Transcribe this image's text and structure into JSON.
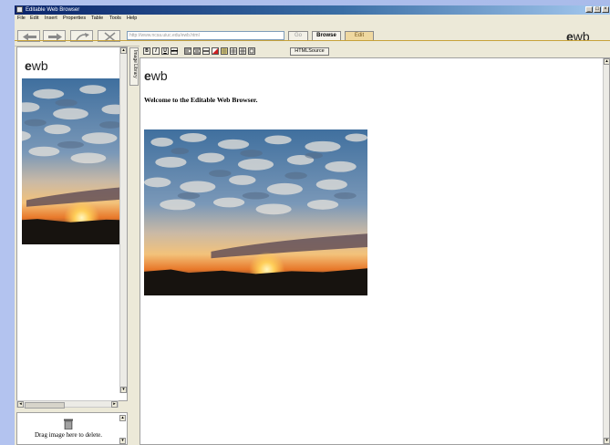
{
  "window": {
    "title": "Editable Web Browser",
    "controls": [
      "_",
      "□",
      "×"
    ]
  },
  "menu": [
    "File",
    "Edit",
    "Insert",
    "Properties",
    "Table",
    "Tools",
    "Help"
  ],
  "nav": {
    "url": "http://www.ncsa.uiuc.edu/ewb.html",
    "go_label": "Go",
    "browse_label": "Browse",
    "edit_label": "Edit",
    "logo_e": "e",
    "logo_rest": "wb"
  },
  "library": {
    "tab_label": "Image Library",
    "logo_e": "e",
    "logo_rest": "wb",
    "trash_label": "Drag image here to delete."
  },
  "editor": {
    "format_buttons": [
      "B",
      "I",
      "U",
      "abc"
    ],
    "html_source_label": "HTMLSource",
    "page": {
      "logo_e": "e",
      "logo_rest": "wb",
      "welcome": "Welcome to the Editable Web Browser."
    }
  }
}
